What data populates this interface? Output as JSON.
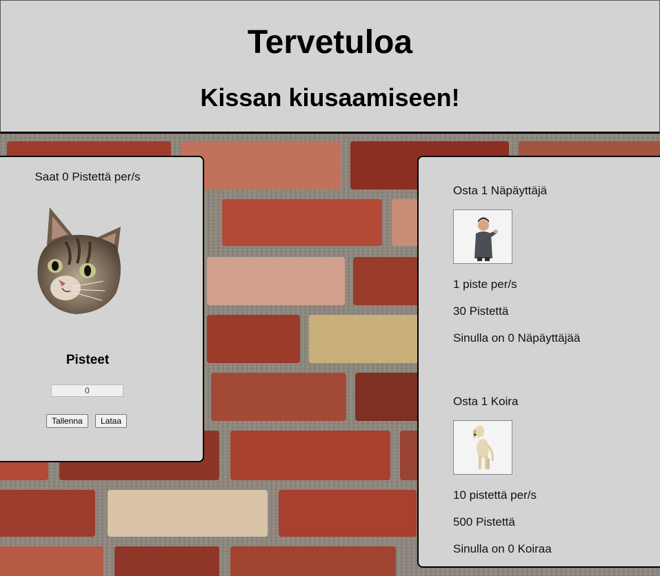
{
  "header": {
    "title": "Tervetuloa",
    "subtitle": "Kissan kiusaamiseen!"
  },
  "clicker": {
    "rate_text": "Saat 0 Pistettä per/s",
    "score_label": "Pisteet",
    "score_value": "0",
    "save_label": "Tallenna",
    "load_label": "Lataa"
  },
  "shop": {
    "items": [
      {
        "buy_label": "Osta 1 Näpäyttäjä",
        "icon": "man-pointing-icon",
        "rate": "1 piste per/s",
        "price": "30 Pistettä",
        "owned": "Sinulla on 0 Näpäyttäjää"
      },
      {
        "buy_label": "Osta 1 Koira",
        "icon": "dog-icon",
        "rate": "10 pistettä per/s",
        "price": "500 Pistettä",
        "owned": "Sinulla on 0 Koiraa"
      }
    ]
  },
  "colors": {
    "panel": "#d3d3d3",
    "brick": "#a0412c",
    "mortar": "#8e877e"
  }
}
